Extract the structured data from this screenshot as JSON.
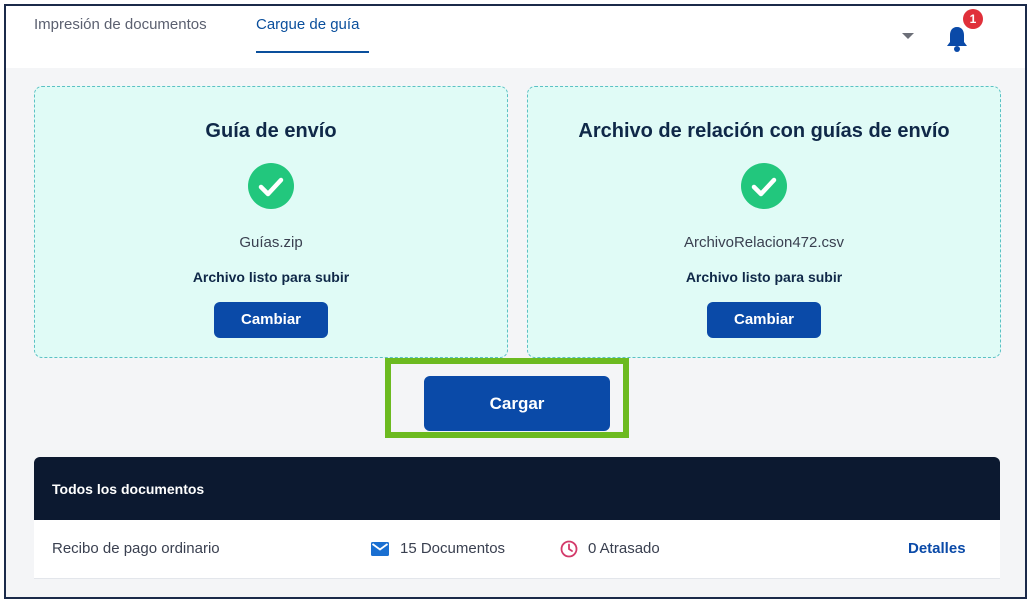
{
  "tabs": [
    {
      "label": "Impresión de documentos"
    },
    {
      "label": "Cargue de guía"
    }
  ],
  "notifications": {
    "count": "1"
  },
  "cards": [
    {
      "title": "Guía de envío",
      "filename": "Guías.zip",
      "status": "Archivo listo para subir",
      "button": "Cambiar"
    },
    {
      "title": "Archivo de relación con guías de envío",
      "filename": "ArchivoRelacion472.csv",
      "status": "Archivo listo para subir",
      "button": "Cambiar"
    }
  ],
  "upload_button": "Cargar",
  "documents": {
    "header": "Todos los documentos",
    "rows": [
      {
        "name": "Recibo de pago ordinario",
        "documents": "15 Documentos",
        "late": "0 Atrasado",
        "action": "Detalles"
      }
    ]
  },
  "colors": {
    "accent": "#0a4aa8",
    "success": "#22c77d",
    "highlight": "#6cba20",
    "badge": "#e0303a"
  }
}
